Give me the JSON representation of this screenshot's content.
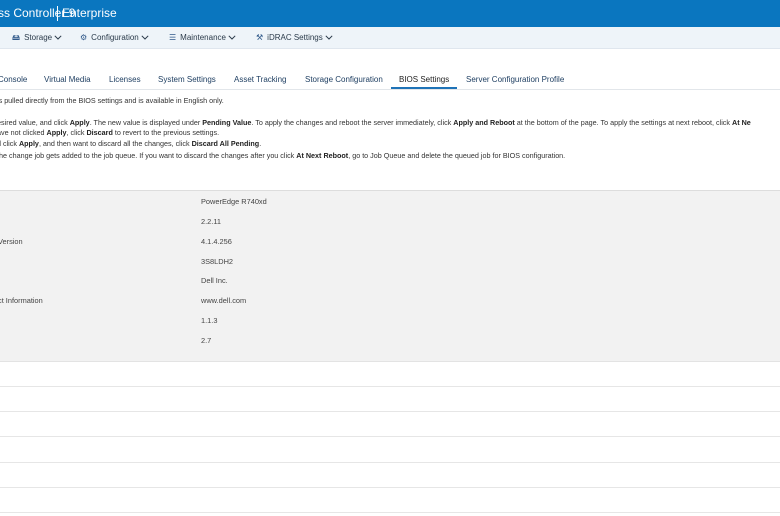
{
  "titlebar": {
    "product": "ss Controller 9",
    "edition": "Enterprise"
  },
  "menu": [
    {
      "label": "Storage",
      "icon": "storage-icon",
      "glyph": "🖴"
    },
    {
      "label": "Configuration",
      "icon": "configuration-icon",
      "glyph": "⚙"
    },
    {
      "label": "Maintenance",
      "icon": "maintenance-icon",
      "glyph": "☰"
    },
    {
      "label": "iDRAC Settings",
      "icon": "idrac-settings-icon",
      "glyph": "⚒"
    }
  ],
  "tabs": [
    {
      "label": "Console"
    },
    {
      "label": "Virtual Media"
    },
    {
      "label": "Licenses"
    },
    {
      "label": "System Settings"
    },
    {
      "label": "Asset Tracking"
    },
    {
      "label": "Storage Configuration"
    },
    {
      "label": "BIOS Settings",
      "active": true
    },
    {
      "label": "Server Configuration Profile"
    }
  ],
  "info": {
    "line1": "is pulled directly from the BIOS settings and is available in English only.",
    "line2": {
      "p1": "esired value, and click ",
      "b1": "Apply",
      "p2": ". The new value is displayed under ",
      "b2": "Pending Value",
      "p3": ". To apply the changes and reboot the server immediately, click ",
      "b3": "Apply and Reboot",
      "p4": " at the bottom of the page. To apply the settings at next reboot, click ",
      "b4": "At Ne"
    },
    "line3": {
      "p1": "ave not clicked ",
      "b1": "Apply",
      "p2": ", click ",
      "b2": "Discard",
      "p3": " to revert to the previous settings."
    },
    "line4": {
      "p1": "d click ",
      "b1": "Apply",
      "p2": ", and then want to discard all the changes, click ",
      "b2": "Discard All Pending",
      "p3": "."
    },
    "line5": {
      "p1": " the change job gets added to the job queue. If you want to discard the changes after you click ",
      "b1": "At Next Reboot",
      "p2": ", go to Job Queue and delete the queued job for BIOS configuration."
    }
  },
  "details": {
    "labels": [
      "Version",
      "ct Information"
    ],
    "values": [
      "PowerEdge R740xd",
      "2.2.11",
      "4.1.4.256",
      "3S8LDH2",
      "Dell Inc.",
      "www.dell.com",
      "1.1.3",
      "2.7"
    ]
  }
}
